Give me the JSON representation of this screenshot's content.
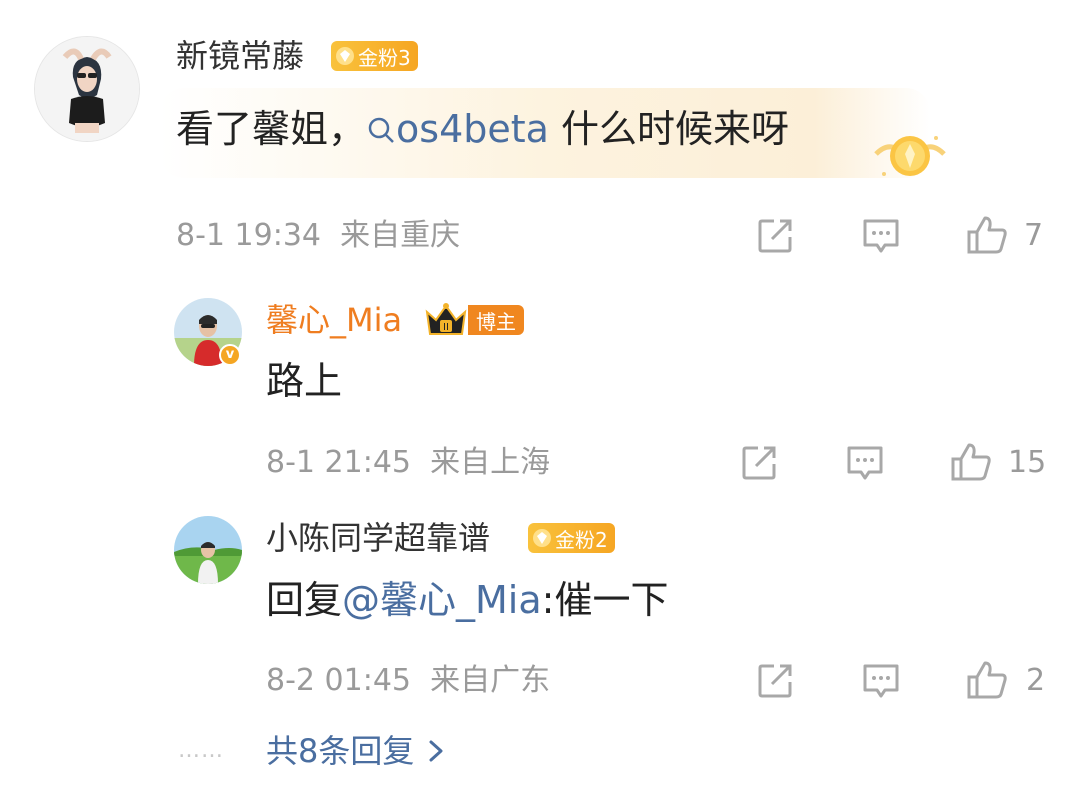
{
  "main_comment": {
    "user": "新镜常藤",
    "badge": "金粉3",
    "text_before": "看了馨姐，",
    "mention": "os4beta",
    "text_after": " 什么时候来呀",
    "time": "8-1 19:34",
    "location": "来自重庆",
    "likes": "7"
  },
  "replies": [
    {
      "user": "馨心_Mia",
      "badge": "博主",
      "crown_level": "II",
      "verified_mark": "v",
      "text": "路上",
      "time": "8-1 21:45",
      "location": "来自上海",
      "likes": "15"
    },
    {
      "user": "小陈同学超靠谱",
      "badge": "金粉2",
      "text_prefix": "回复",
      "mention": "@馨心_Mia",
      "text_after": ":催一下",
      "time": "8-2 01:45",
      "location": "来自广东",
      "likes": "2"
    }
  ],
  "more_replies": {
    "dots": "……",
    "label": "共8条回复"
  },
  "colors": {
    "link": "#4a6ea0",
    "meta": "#9a9a9a",
    "blogger_name": "#ef7d20",
    "gold_badge": "#f6a623"
  },
  "icons": [
    "share-icon",
    "comment-icon",
    "like-icon",
    "search-mention-icon",
    "chevron-right-icon"
  ]
}
